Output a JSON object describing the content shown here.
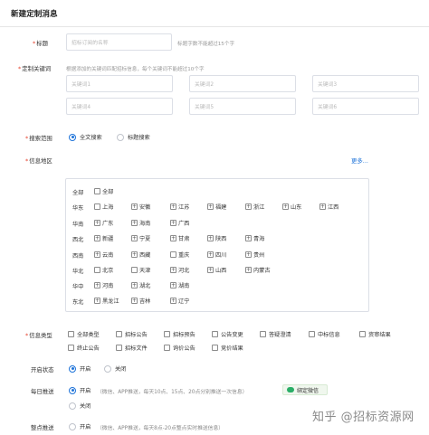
{
  "header": {
    "title": "新建定制消息"
  },
  "title_field": {
    "label": "标题",
    "placeholder": "招标订阅的名称",
    "hint": "标题字数不能超过15个字"
  },
  "keywords": {
    "label": "定制关键词",
    "hint": "根据添加的关键词匹配招标信息，每个关键词不能超过10个字",
    "placeholders": [
      "关键词1",
      "关键词2",
      "关键词3",
      "关键词4",
      "关键词5",
      "关键词6"
    ]
  },
  "scope": {
    "label": "搜索范围",
    "options": [
      "全文搜索",
      "标题搜索"
    ],
    "selected": "全文搜索"
  },
  "region": {
    "label": "信息地区",
    "more": "更多...",
    "rows": [
      {
        "name": "全部",
        "items": [
          {
            "label": "全部",
            "expand": false
          }
        ]
      },
      {
        "name": "华东",
        "items": [
          {
            "label": "上海",
            "expand": false
          },
          {
            "label": "安徽",
            "expand": true
          },
          {
            "label": "江苏",
            "expand": true
          },
          {
            "label": "福建",
            "expand": true
          },
          {
            "label": "浙江",
            "expand": true
          },
          {
            "label": "山东",
            "expand": true
          },
          {
            "label": "江西",
            "expand": true
          }
        ]
      },
      {
        "name": "华南",
        "items": [
          {
            "label": "广东",
            "expand": true
          },
          {
            "label": "海南",
            "expand": true
          },
          {
            "label": "广西",
            "expand": true
          }
        ]
      },
      {
        "name": "西北",
        "items": [
          {
            "label": "新疆",
            "expand": true
          },
          {
            "label": "宁夏",
            "expand": true
          },
          {
            "label": "甘肃",
            "expand": true
          },
          {
            "label": "陕西",
            "expand": true
          },
          {
            "label": "青海",
            "expand": true
          }
        ]
      },
      {
        "name": "西南",
        "items": [
          {
            "label": "云南",
            "expand": true
          },
          {
            "label": "西藏",
            "expand": true
          },
          {
            "label": "重庆",
            "expand": false
          },
          {
            "label": "四川",
            "expand": true
          },
          {
            "label": "贵州",
            "expand": true
          }
        ]
      },
      {
        "name": "华北",
        "items": [
          {
            "label": "北京",
            "expand": false
          },
          {
            "label": "天津",
            "expand": false
          },
          {
            "label": "河北",
            "expand": true
          },
          {
            "label": "山西",
            "expand": true
          },
          {
            "label": "内蒙古",
            "expand": true
          }
        ]
      },
      {
        "name": "华中",
        "items": [
          {
            "label": "河南",
            "expand": true
          },
          {
            "label": "湖北",
            "expand": true
          },
          {
            "label": "湖南",
            "expand": true
          }
        ]
      },
      {
        "name": "东北",
        "items": [
          {
            "label": "黑龙江",
            "expand": true
          },
          {
            "label": "吉林",
            "expand": true
          },
          {
            "label": "辽宁",
            "expand": true
          }
        ]
      }
    ]
  },
  "info_type": {
    "label": "信息类型",
    "row1": [
      "全部类型",
      "招标公告",
      "招标预告",
      "公告变更",
      "答疑澄清",
      "中标信息",
      "资审结果"
    ],
    "row2": [
      "终止公告",
      "招标文件",
      "询价公告",
      "竞价结果"
    ]
  },
  "open_status": {
    "label": "开启状态",
    "options": [
      "开启",
      "关闭"
    ],
    "selected": "开启"
  },
  "daily_push": {
    "label": "每日推送",
    "on_label": "开启",
    "on_desc": "（微信、APP推送，每天10点、15点、20点分别推送一次信息）",
    "off_label": "关闭",
    "wechat_button": "绑定微信"
  },
  "hourly_push": {
    "label": "整点推送",
    "on_label": "开启",
    "on_desc": "（微信、APP推送，每天8点-20点整点实时推送信息）"
  },
  "watermark": "知乎 @招标资源网",
  "colors": {
    "accent": "#1e73d9",
    "required": "#e6432f",
    "wechat": "#2aae67"
  }
}
